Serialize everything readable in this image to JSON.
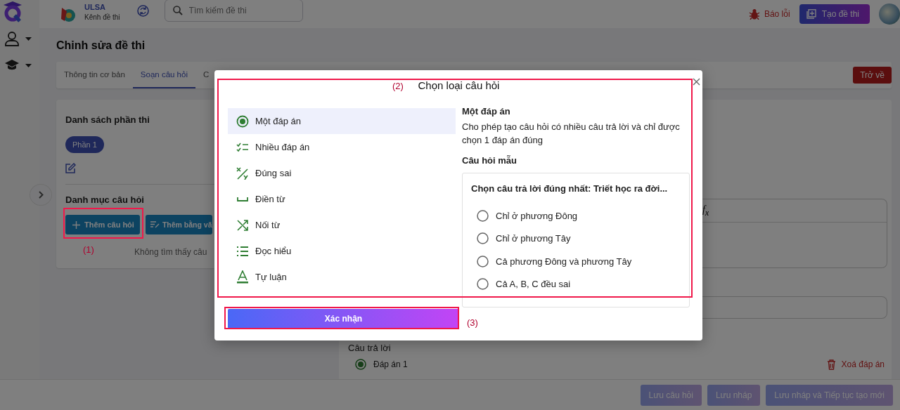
{
  "header": {
    "org_name": "ULSA",
    "channel": "Kênh đề thi",
    "search": {
      "placeholder": "Tìm kiếm đề thi"
    },
    "report_button": "Báo lỗi",
    "create_button": "Tạo đề thi"
  },
  "page": {
    "title": "Chỉnh sửa đề thi",
    "back_button": "Trở về",
    "tabs": [
      {
        "label": "Thông tin cơ bản",
        "selected": false
      },
      {
        "label": "Soạn câu hỏi",
        "selected": true
      },
      {
        "label": "C",
        "selected": false
      }
    ]
  },
  "left_panel": {
    "sections_title": "Danh sách phần thi",
    "sections": [
      {
        "label": "Phần 1",
        "selected": true
      }
    ],
    "categories_title": "Danh mục câu hỏi",
    "add_button": "Thêm câu hỏi",
    "add_text_button": "Thêm bằng vă",
    "empty_text": "Không tìm thấy câu"
  },
  "editor": {
    "formula_button": "f$_{x}$",
    "answers_label": "Câu trả lời",
    "answers": [
      {
        "label": "Đáp án 1",
        "selected": true
      }
    ],
    "delete_answer": "Xoá đáp án"
  },
  "footer": {
    "buttons": [
      "Lưu câu hỏi",
      "Lưu nháp",
      "Lưu nháp và Tiếp tục tạo mới"
    ]
  },
  "modal": {
    "title": "Chọn loại câu hỏi",
    "types": [
      {
        "kind": "single",
        "label": "Một đáp án",
        "selected": true
      },
      {
        "kind": "multiple",
        "label": "Nhiều đáp án",
        "selected": false
      },
      {
        "kind": "truefalse",
        "label": "Đúng sai",
        "selected": false
      },
      {
        "kind": "fill",
        "label": "Điền từ",
        "selected": false
      },
      {
        "kind": "match",
        "label": "Nối từ",
        "selected": false
      },
      {
        "kind": "reading",
        "label": "Đọc hiểu",
        "selected": false
      },
      {
        "kind": "essay",
        "label": "Tự luận",
        "selected": false
      }
    ],
    "detail": {
      "title": "Một đáp án",
      "description": "Cho phép tạo câu hỏi có nhiều câu trả lời và chỉ được chọn 1 đáp án đúng",
      "sample_label": "Câu hỏi mẫu",
      "sample_question": "Chọn câu trả lời đúng nhất: Triết học ra đời...",
      "sample_options": [
        "Chỉ ở phương Đông",
        "Chỉ ở phương Tây",
        "Cả phương Đông và phương Tây",
        "Cả A, B, C đều sai"
      ]
    },
    "confirm_button": "Xác nhận"
  },
  "annotations": [
    {
      "label": "(1)"
    },
    {
      "label": "(2)"
    },
    {
      "label": "(3)"
    }
  ]
}
